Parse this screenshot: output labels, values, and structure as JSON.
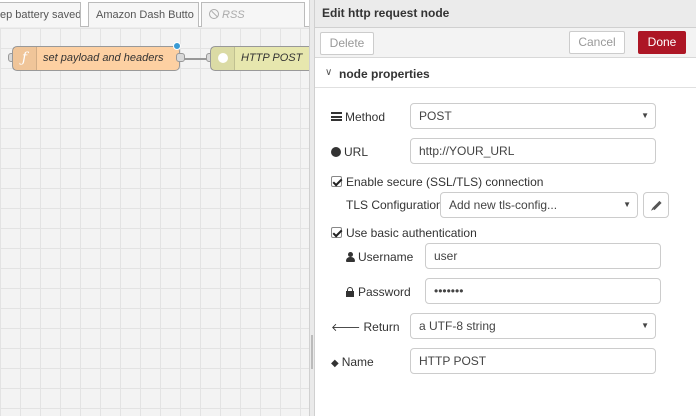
{
  "workspace": {
    "tabs": [
      {
        "label": "ep battery saved"
      },
      {
        "label": "Amazon Dash Butto"
      },
      {
        "label": "RSS"
      }
    ],
    "nodes": [
      {
        "label": "set payload and headers",
        "icon": "function-icon",
        "color": "#fdd0a2"
      },
      {
        "label": "HTTP POST",
        "icon": "globe-icon",
        "color": "#e7e7ae"
      }
    ]
  },
  "tray": {
    "title": "Edit http request node",
    "delete_label": "Delete",
    "cancel_label": "Cancel",
    "done_label": "Done",
    "done_color": "#ad1625",
    "section_title": "node properties",
    "method": {
      "label": "Method",
      "value": "POST"
    },
    "url": {
      "label": "URL",
      "value": "http://YOUR_URL"
    },
    "tls_enable": {
      "label": "Enable secure (SSL/TLS) connection",
      "checked": true
    },
    "tls_config": {
      "label": "TLS Configuration",
      "value": "Add new tls-config..."
    },
    "basic_auth": {
      "label": "Use basic authentication",
      "checked": true
    },
    "username": {
      "label": "Username",
      "value": "user"
    },
    "password": {
      "label": "Password",
      "value": "•••••••"
    },
    "return": {
      "label": "Return",
      "value": "a UTF-8 string"
    },
    "name": {
      "label": "Name",
      "value": "HTTP POST"
    }
  }
}
